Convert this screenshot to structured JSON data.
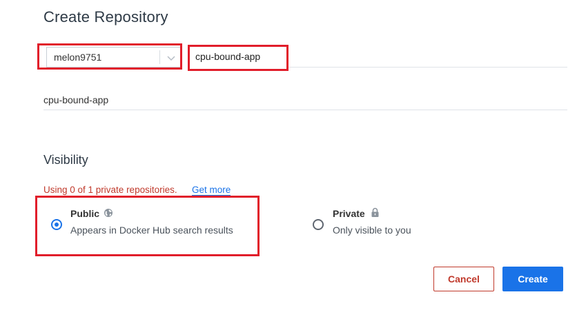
{
  "page": {
    "title": "Create Repository"
  },
  "form": {
    "namespace_value": "melon9751",
    "name_value": "cpu-bound-app",
    "description_value": "cpu-bound-app"
  },
  "visibility": {
    "title": "Visibility",
    "usage_text": "Using 0 of 1 private repositories.",
    "get_more_label": "Get more",
    "public": {
      "title": "Public",
      "subtitle": "Appears in Docker Hub search results",
      "selected": true,
      "icon": "globe-icon"
    },
    "private": {
      "title": "Private",
      "subtitle": "Only visible to you",
      "selected": false,
      "icon": "lock-icon"
    }
  },
  "actions": {
    "cancel_label": "Cancel",
    "create_label": "Create"
  },
  "colors": {
    "accent": "#1a73e8",
    "danger": "#c0392b",
    "highlight": "#e11d2a"
  }
}
